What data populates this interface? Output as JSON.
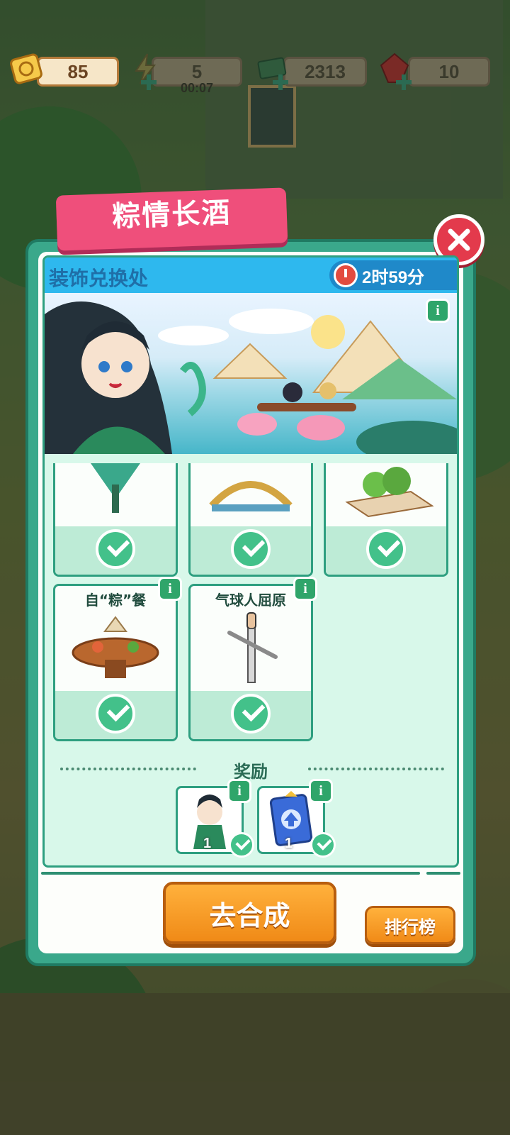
{
  "resources": {
    "coupon": "85",
    "energy": "5",
    "energy_timer": "00:07",
    "cash": "2313",
    "gem": "10"
  },
  "event": {
    "title": "粽情长酒",
    "shop_title": "装饰兑换处",
    "time_left": "2时59分"
  },
  "items": [
    {
      "name": "",
      "claimed": true
    },
    {
      "name": "",
      "claimed": true
    },
    {
      "name": "",
      "claimed": true
    },
    {
      "name": "自“粽”餐",
      "claimed": true
    },
    {
      "name": "气球人屈原",
      "claimed": true
    }
  ],
  "rewards": {
    "title": "奖励",
    "list": [
      {
        "icon": "character-avatar-icon",
        "count": "1",
        "claimed": true
      },
      {
        "icon": "upgrade-card-icon",
        "count": "1",
        "claimed": true
      }
    ]
  },
  "buttons": {
    "merge": "去合成",
    "leaderboard": "排行榜"
  },
  "info_icon_glyph": "i"
}
